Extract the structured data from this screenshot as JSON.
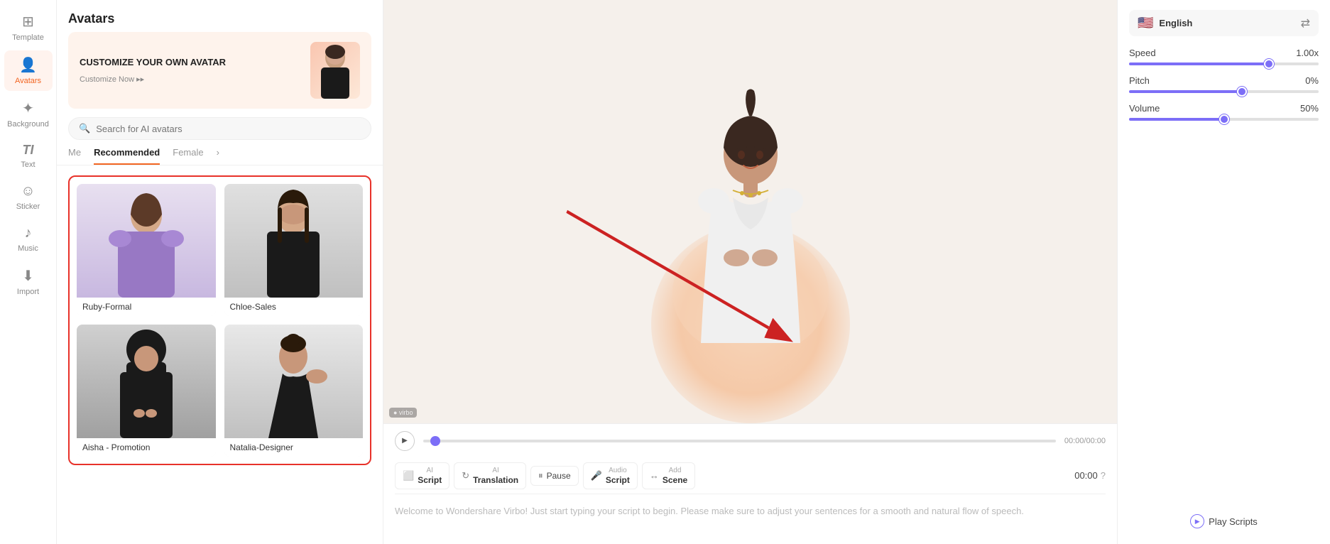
{
  "sidebar": {
    "items": [
      {
        "id": "template",
        "label": "Template",
        "icon": "⊞",
        "active": false
      },
      {
        "id": "avatars",
        "label": "Avatars",
        "icon": "👤",
        "active": true
      },
      {
        "id": "background",
        "label": "Background",
        "icon": "✦",
        "active": false
      },
      {
        "id": "text",
        "label": "Text",
        "icon": "T",
        "active": false
      },
      {
        "id": "sticker",
        "label": "Sticker",
        "icon": "☺",
        "active": false
      },
      {
        "id": "music",
        "label": "Music",
        "icon": "♪",
        "active": false
      },
      {
        "id": "import",
        "label": "Import",
        "icon": "⬇",
        "active": false
      }
    ]
  },
  "avatar_panel": {
    "title": "Avatars",
    "customize_banner": {
      "title": "CUSTOMIZE YOUR OWN AVATAR",
      "button_label": "Customize Now ▸▸"
    },
    "search_placeholder": "Search for AI avatars",
    "tabs": [
      {
        "label": "Me",
        "active": false
      },
      {
        "label": "Recommended",
        "active": true
      },
      {
        "label": "Female",
        "active": false
      }
    ],
    "avatars": [
      {
        "id": "ruby",
        "name": "Ruby-Formal",
        "style": "ruby"
      },
      {
        "id": "chloe",
        "name": "Chloe-Sales",
        "style": "chloe"
      },
      {
        "id": "aisha",
        "name": "Aisha - Promotion",
        "style": "aisha"
      },
      {
        "id": "natalia",
        "name": "Natalia-Designer",
        "style": "natalia"
      }
    ]
  },
  "toolbar": {
    "ai_script_label1": "AI",
    "ai_script_label2": "Script",
    "ai_translation_label1": "AI",
    "ai_translation_label2": "Translation",
    "pause_label": "Pause",
    "audio_script_label1": "Audio",
    "audio_script_label2": "Script",
    "add_scene_label1": "Add",
    "add_scene_label2": "Scene",
    "time_display": "00:00",
    "time_icon": "?"
  },
  "script": {
    "placeholder": "Welcome to Wondershare Virbo! Just start typing your script to begin. Please make sure to adjust your sentences for a smooth and natural flow of speech."
  },
  "playback": {
    "time": "00:00/00:00"
  },
  "right_panel": {
    "language": "English",
    "speed_label": "Speed",
    "speed_value": "1.00x",
    "pitch_label": "Pitch",
    "pitch_value": "0%",
    "volume_label": "Volume",
    "volume_value": "50%",
    "play_scripts_label": "Play Scripts"
  }
}
